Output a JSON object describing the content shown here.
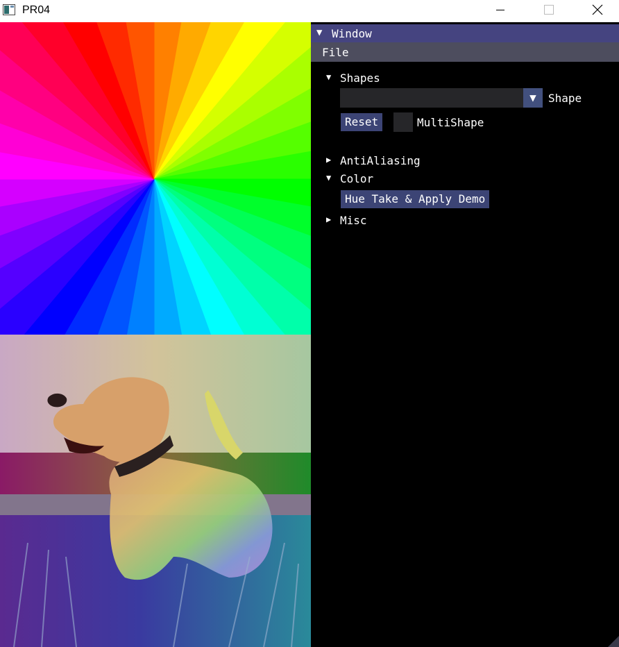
{
  "window": {
    "title": "PR04",
    "icon": "app-window-icon",
    "controls": [
      "minimize-icon",
      "maximize-icon",
      "close-icon"
    ]
  },
  "panel": {
    "title": "Window",
    "menu": {
      "file": "File"
    },
    "shapes": {
      "header": "Shapes",
      "combo_value": "",
      "combo_label": "Shape",
      "reset_label": "Reset",
      "multishape_label": "MultiShape"
    },
    "antialiasing": {
      "header": "AntiAliasing"
    },
    "color": {
      "header": "Color",
      "hue_button_label": "Hue Take & Apply Demo"
    },
    "misc": {
      "header": "Misc"
    }
  },
  "colors": {
    "title_bar_active": "#454480",
    "menu_bar": "#4d4d5e",
    "button": "#3c4475",
    "frame_bg": "#262629",
    "panel_bg": "#000000"
  }
}
